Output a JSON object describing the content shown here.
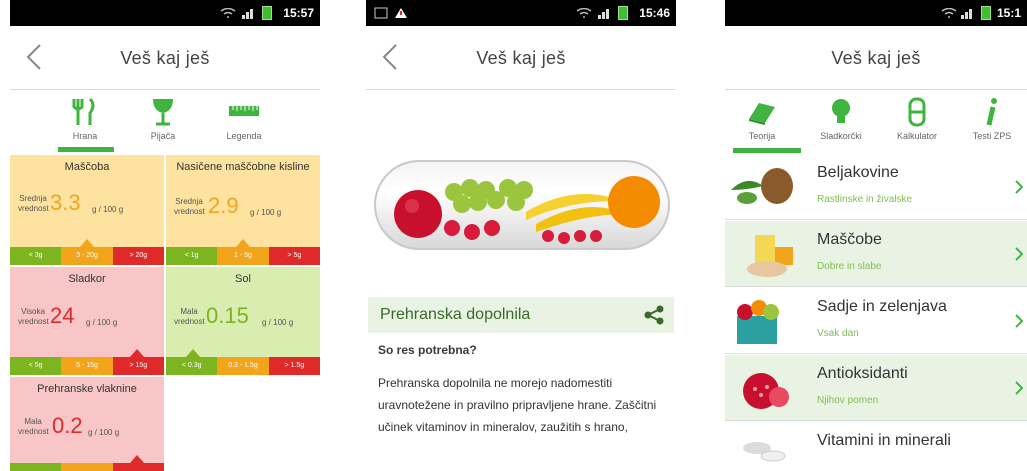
{
  "screen1": {
    "status": {
      "time": "15:57"
    },
    "appbar": {
      "title": "Veš kaj ješ"
    },
    "tabs": [
      {
        "label": "Hrana",
        "icon": "cutlery-icon"
      },
      {
        "label": "Pijača",
        "icon": "wine-glass-icon"
      },
      {
        "label": "Legenda",
        "icon": "ruler-icon"
      }
    ],
    "cells": [
      {
        "title": "Maščoba",
        "qualifier": "Srednja vrednost",
        "value": "3.3",
        "unit": "g / 100 g",
        "scale": [
          "< 3g",
          "3 - 20g",
          "> 20g"
        ],
        "level": "medium"
      },
      {
        "title": "Nasičene maščobne kisline",
        "qualifier": "Srednja vrednost",
        "value": "2.9",
        "unit": "g / 100 g",
        "scale": [
          "< 1g",
          "1 - 5g",
          "> 5g"
        ],
        "level": "medium"
      },
      {
        "title": "Sladkor",
        "qualifier": "Visoka vrednost",
        "value": "24",
        "unit": "g / 100 g",
        "scale": [
          "< 5g",
          "5 - 15g",
          "> 15g"
        ],
        "level": "high"
      },
      {
        "title": "Sol",
        "qualifier": "Mala vrednost",
        "value": "0.15",
        "unit": "g / 100 g",
        "scale": [
          "< 0.3g",
          "0.3 - 1.5g",
          "> 1.5g"
        ],
        "level": "low"
      },
      {
        "title": "Prehranske vlaknine",
        "qualifier": "Mala vrednost",
        "value": "0.2",
        "unit": "g / 100 g",
        "scale": [
          "",
          "",
          ""
        ],
        "level": "high"
      }
    ]
  },
  "screen2": {
    "status": {
      "time": "15:46"
    },
    "appbar": {
      "title": "Veš kaj ješ"
    },
    "section_title": "Prehranska dopolnila",
    "subheading": "So res potrebna?",
    "body": "Prehranska dopolnila ne morejo nadomestiti uravnotežene in pravilno pripravljene hrane. Zaščitni učinek vitaminov in mineralov, zaužitih s hrano,"
  },
  "screen3": {
    "status": {
      "time": "15:1"
    },
    "appbar": {
      "title": "Veš kaj ješ"
    },
    "tabs": [
      {
        "label": "Teorija",
        "icon": "book-icon"
      },
      {
        "label": "Sladkorčki",
        "icon": "lightbulb-icon"
      },
      {
        "label": "Kalkulator",
        "icon": "calculator-icon"
      },
      {
        "label": "Testi ZPS",
        "icon": "info-icon"
      }
    ],
    "items": [
      {
        "title": "Beljakovine",
        "subtitle": "Rastlinske in živalske"
      },
      {
        "title": "Maščobe",
        "subtitle": "Dobre in slabe"
      },
      {
        "title": "Sadje in zelenjava",
        "subtitle": "Vsak dan"
      },
      {
        "title": "Antioksidanti",
        "subtitle": "Njihov pomen"
      },
      {
        "title": "Vitamini in minerali",
        "subtitle": ""
      }
    ]
  },
  "colors": {
    "green": "#3fb53f",
    "amber_bg": "#fde2a0",
    "red_bg": "#f8c6c6",
    "green_bg": "#d9edb0",
    "value_amber": "#f2a51a",
    "value_red": "#e02a2a",
    "value_green": "#7cb520"
  }
}
